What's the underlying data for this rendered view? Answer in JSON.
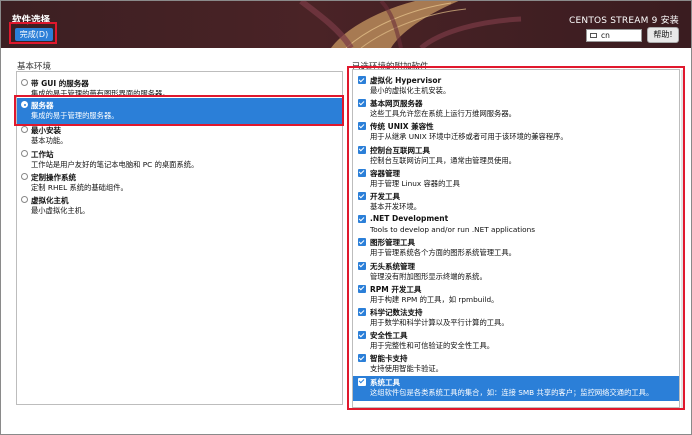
{
  "header": {
    "title": "软件选择",
    "done_label": "完成(D)",
    "product": "CENTOS STREAM 9 安装",
    "keyboard_layout": "cn",
    "help_label": "帮助!"
  },
  "base_environment": {
    "label": "基本环境",
    "selected_index": 1,
    "items": [
      {
        "name": "带 GUI 的服务器",
        "desc": "集成的易于管理的带有图形界面的服务器。"
      },
      {
        "name": "服务器",
        "desc": "集成的易于管理的服务器。"
      },
      {
        "name": "最小安装",
        "desc": "基本功能。"
      },
      {
        "name": "工作站",
        "desc": "工作站是用户友好的笔记本电脑和 PC 的桌面系统。"
      },
      {
        "name": "定制操作系统",
        "desc": "定制 RHEL 系统的基础组件。"
      },
      {
        "name": "虚拟化主机",
        "desc": "最小虚拟化主机。"
      }
    ]
  },
  "addons": {
    "label": "已选环境的附加软件",
    "selected_index": 13,
    "items": [
      {
        "name": "虚拟化 Hypervisor",
        "desc": "最小的虚拟化主机安装。",
        "checked": true
      },
      {
        "name": "基本网页服务器",
        "desc": "这些工具允许您在系统上运行万维网服务器。",
        "checked": true
      },
      {
        "name": "传统 UNIX 兼容性",
        "desc": "用于从继承 UNIX 环境中迁移或者可用于该环境的兼容程序。",
        "checked": true
      },
      {
        "name": "控制台互联网工具",
        "desc": "控制台互联网访问工具，通常由管理员使用。",
        "checked": true
      },
      {
        "name": "容器管理",
        "desc": "用于管理 Linux 容器的工具",
        "checked": true
      },
      {
        "name": "开发工具",
        "desc": "基本开发环境。",
        "checked": true
      },
      {
        "name": ".NET Development",
        "desc": "Tools to develop and/or run .NET applications",
        "checked": true
      },
      {
        "name": "图形管理工具",
        "desc": "用于管理系统各个方面的图形系统管理工具。",
        "checked": true
      },
      {
        "name": "无头系统管理",
        "desc": "管理没有附加图形显示终端的系统。",
        "checked": true
      },
      {
        "name": "RPM 开发工具",
        "desc": "用于构建 RPM 的工具，如 rpmbuild。",
        "checked": true
      },
      {
        "name": "科学记数法支持",
        "desc": "用于数学和科学计算以及平行计算的工具。",
        "checked": true
      },
      {
        "name": "安全性工具",
        "desc": "用于完整性和可信验证的安全性工具。",
        "checked": true
      },
      {
        "name": "智能卡支持",
        "desc": "支持使用智能卡验证。",
        "checked": true
      },
      {
        "name": "系统工具",
        "desc": "这组软件包是各类系统工具的集合，如：连接 SMB 共享的客户；监控网络交通的工具。",
        "checked": true
      }
    ]
  }
}
